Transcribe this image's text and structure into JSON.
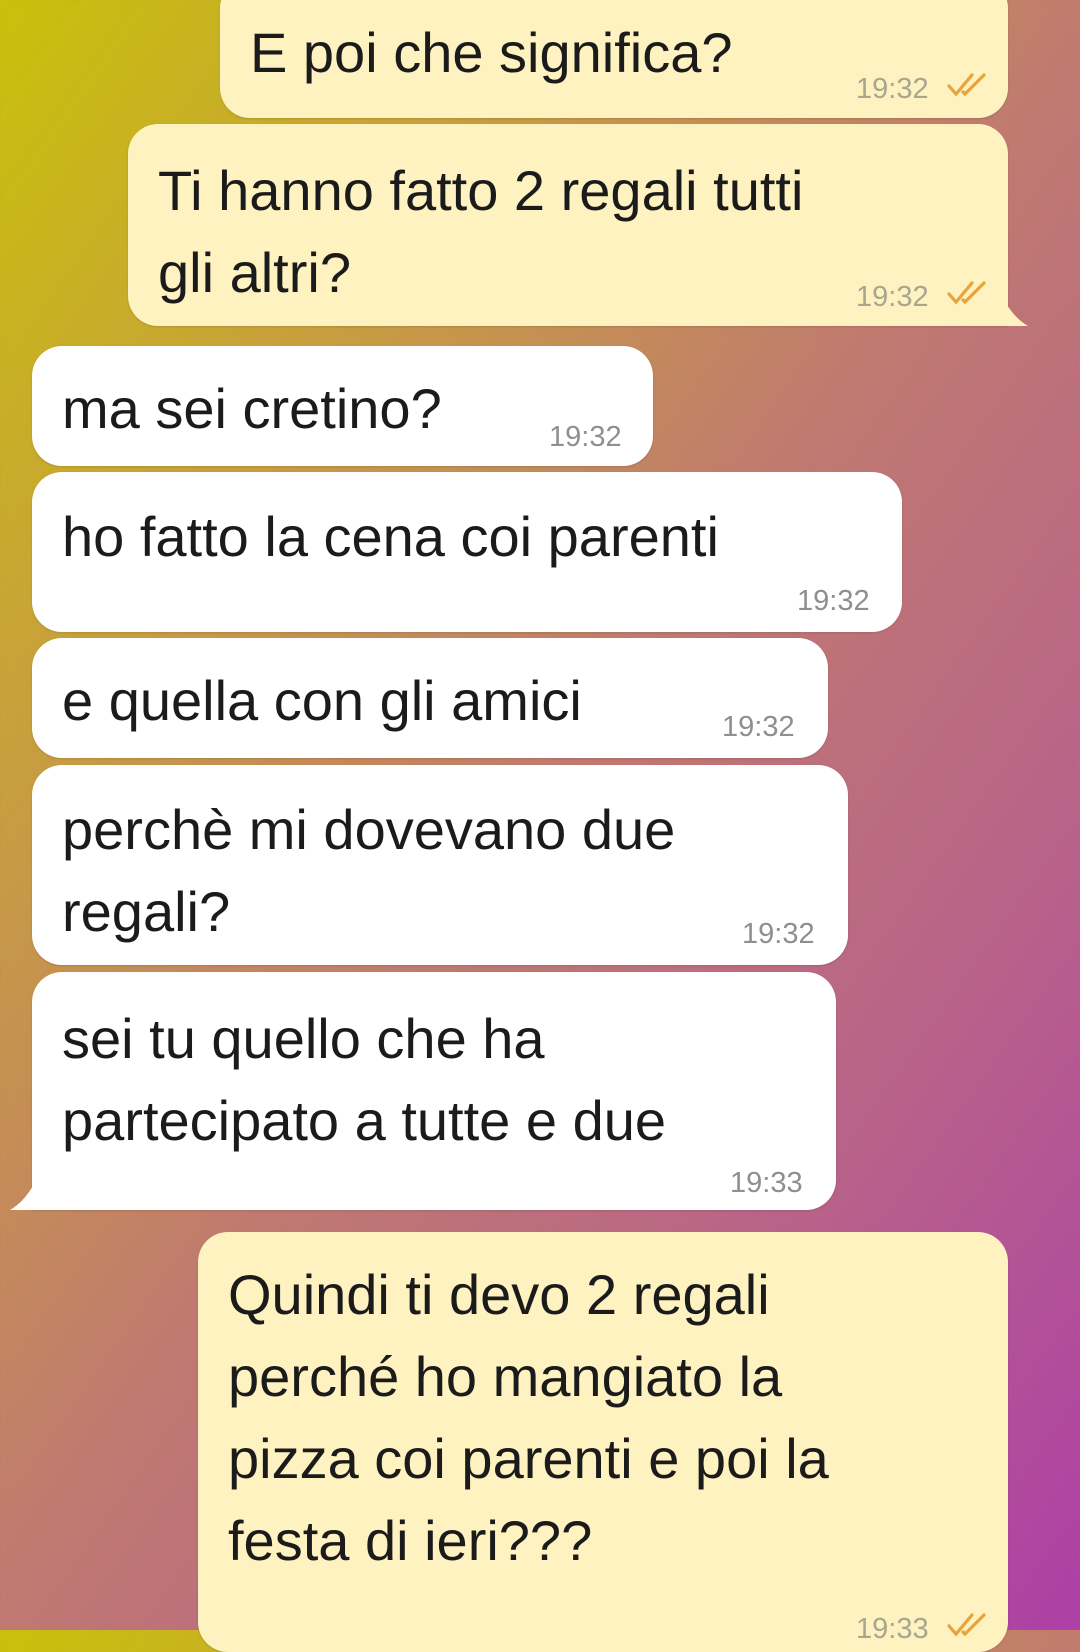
{
  "messages": [
    {
      "dir": "out",
      "text": "E poi che significa?",
      "time": "19:32",
      "status": "read"
    },
    {
      "dir": "out",
      "text": "Ti hanno fatto 2 regali tutti\ngli altri?",
      "time": "19:32",
      "status": "read"
    },
    {
      "dir": "in",
      "text": "ma sei cretino?",
      "time": "19:32"
    },
    {
      "dir": "in",
      "text": "ho fatto la cena coi parenti",
      "time": "19:32"
    },
    {
      "dir": "in",
      "text": "e quella con gli amici",
      "time": "19:32"
    },
    {
      "dir": "in",
      "text": "perchè mi dovevano due\nregali?",
      "time": "19:32"
    },
    {
      "dir": "in",
      "text": "sei tu quello che ha\npartecipato a tutte e due",
      "time": "19:33"
    },
    {
      "dir": "out",
      "text": "Quindi ti devo 2 regali\nperché ho mangiato la\npizza coi parenti e poi la\nfesta di ieri???",
      "time": "19:33",
      "status": "read"
    }
  ],
  "colors": {
    "outgoing_bubble": "#fdf2c0",
    "incoming_bubble": "#ffffff",
    "read_check": "#e8a33c",
    "timestamp": "#8f8f8f"
  },
  "icons": {
    "read_status": "double-check-icon"
  }
}
